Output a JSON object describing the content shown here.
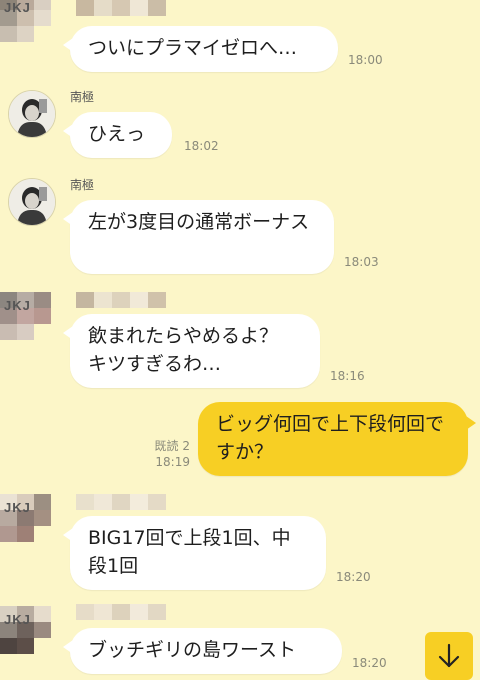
{
  "messages": [
    {
      "sender": "JKJ",
      "text": "ついにプラマイゼロへ…",
      "time": "18:00"
    },
    {
      "sender": "南極",
      "text": "ひえっ",
      "time": "18:02"
    },
    {
      "sender": "南極",
      "text": "左が3度目の通常ボーナス",
      "time": "18:03"
    },
    {
      "sender": "JKJ",
      "text": "飲まれたらやめるよ？\nキツすぎるわ…",
      "time": "18:16"
    },
    {
      "sender": "me",
      "text": "ビッグ何回で上下段何回ですか？",
      "time": "18:19",
      "read": "既読 2"
    },
    {
      "sender": "JKJ",
      "text": "BIG17回で上段1回、中段1回",
      "time": "18:20"
    },
    {
      "sender": "JKJ",
      "text": "ブッチギリの島ワースト",
      "time": "18:20"
    }
  ],
  "scroll_button": {
    "icon": "arrow-down-icon"
  },
  "colors": {
    "background": "#fcf6c8",
    "incoming": "#ffffff",
    "outgoing": "#f7cf24"
  }
}
